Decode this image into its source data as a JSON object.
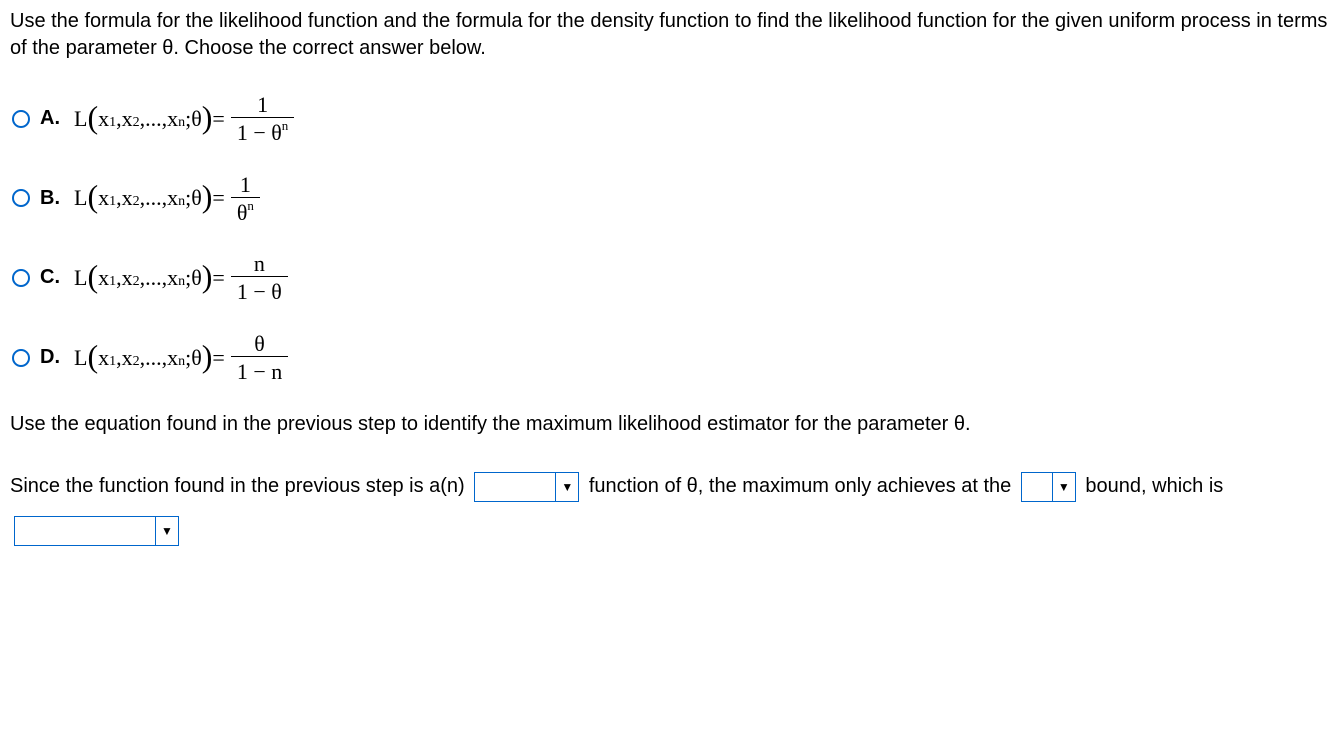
{
  "question": "Use the formula for the likelihood function and the formula for the density function to find the likelihood function for the given uniform process in terms of the parameter θ. Choose the correct answer below.",
  "lhs_prefix": "L",
  "lhs_args": "x₁,x₂,...,xₙ;θ",
  "equals": " = ",
  "options": {
    "A": {
      "letter": "A.",
      "num": "1",
      "den_pre": "1 − θ",
      "den_sup": "n"
    },
    "B": {
      "letter": "B.",
      "num": "1",
      "den_pre": "θ",
      "den_sup": "n"
    },
    "C": {
      "letter": "C.",
      "num": "n",
      "den_pre": "1 − θ",
      "den_sup": ""
    },
    "D": {
      "letter": "D.",
      "num": "θ",
      "den_pre": "1 − n",
      "den_sup": ""
    }
  },
  "follow_up": "Use the equation found in the previous step to identify the maximum likelihood estimator for the parameter θ.",
  "fill": {
    "part1": "Since the function found in the previous step is a(n) ",
    "part2": " function of θ, the maximum only achieves at the ",
    "part3": " bound, which is ",
    "arrow": "▼"
  }
}
